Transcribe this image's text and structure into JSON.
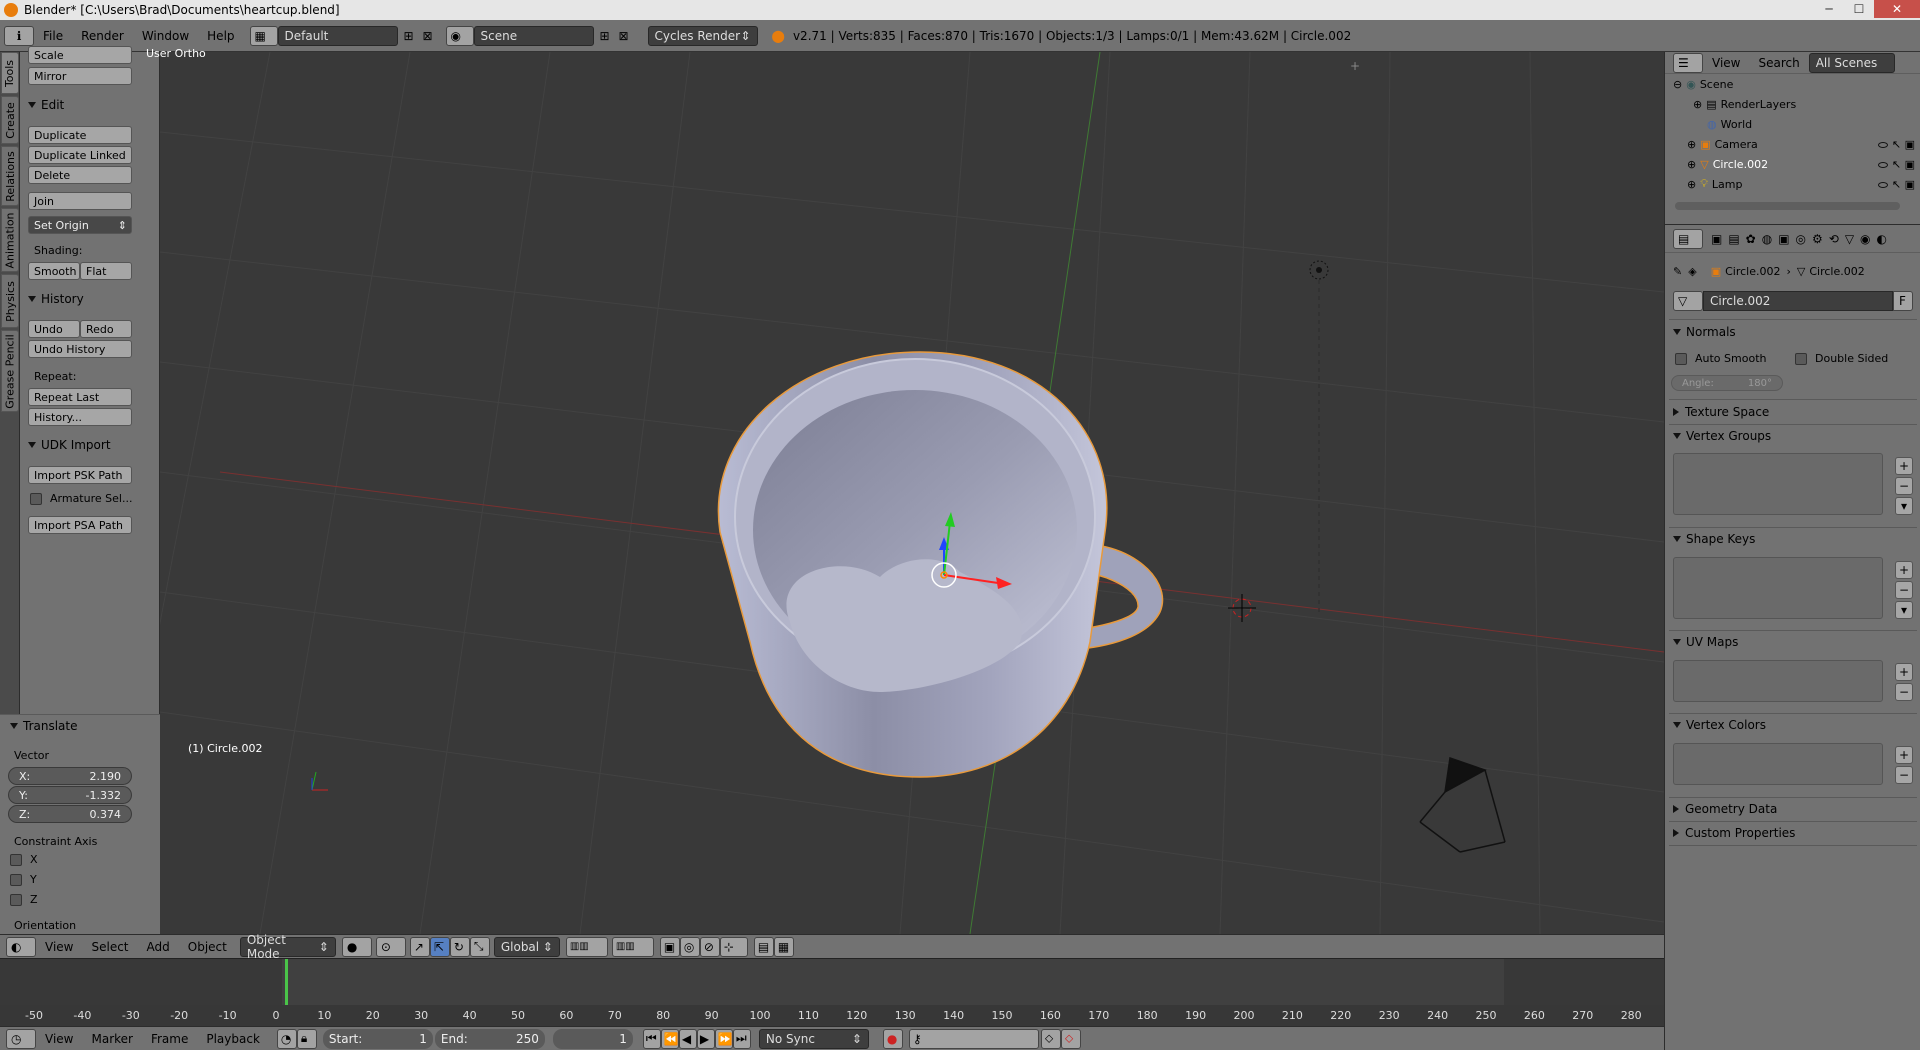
{
  "window": {
    "title": "Blender* [C:\\Users\\Brad\\Documents\\heartcup.blend]",
    "min": "─",
    "max": "☐",
    "close": "✕"
  },
  "infobar": {
    "menus": [
      "File",
      "Render",
      "Window",
      "Help"
    ],
    "layout": "Default",
    "scene": "Scene",
    "engine": "Cycles Render",
    "stats": "v2.71 | Verts:835 | Faces:870 | Tris:1670 | Objects:1/3 | Lamps:0/1 | Mem:43.62M | Circle.002"
  },
  "tabs": [
    "Tools",
    "Create",
    "Relations",
    "Animation",
    "Physics",
    "Grease Pencil"
  ],
  "tools": {
    "scale": "Scale",
    "mirror": "Mirror",
    "edit_header": "Edit",
    "duplicate": "Duplicate",
    "duplicate_linked": "Duplicate Linked",
    "delete": "Delete",
    "join": "Join",
    "set_origin": "Set Origin",
    "shading_label": "Shading:",
    "smooth": "Smooth",
    "flat": "Flat",
    "history_header": "History",
    "undo": "Undo",
    "redo": "Redo",
    "undo_history": "Undo History",
    "repeat_label": "Repeat:",
    "repeat_last": "Repeat Last",
    "history_btn": "History...",
    "udk_header": "UDK Import",
    "import_psk": "Import PSK Path",
    "armature": "Armature Sel...",
    "import_psa": "Import PSA Path"
  },
  "operator": {
    "header": "Translate",
    "vector_label": "Vector",
    "x_label": "X:",
    "x": "2.190",
    "y_label": "Y:",
    "y": "-1.332",
    "z_label": "Z:",
    "z": "0.374",
    "constraint_label": "Constraint Axis",
    "cx": "X",
    "cy": "Y",
    "cz": "Z",
    "orientation_label": "Orientation"
  },
  "viewport": {
    "view_name": "User Ortho",
    "object_label": "(1) Circle.002"
  },
  "view_header": {
    "menus": [
      "View",
      "Select",
      "Add",
      "Object"
    ],
    "mode": "Object Mode",
    "orientation": "Global"
  },
  "timeline": {
    "ticks": [
      "-50",
      "-40",
      "-30",
      "-20",
      "-10",
      "0",
      "10",
      "20",
      "30",
      "40",
      "50",
      "60",
      "70",
      "80",
      "90",
      "100",
      "110",
      "120",
      "130",
      "140",
      "150",
      "160",
      "170",
      "180",
      "190",
      "200",
      "210",
      "220",
      "230",
      "240",
      "250",
      "260",
      "270",
      "280"
    ],
    "menus": [
      "View",
      "Marker",
      "Frame",
      "Playback"
    ],
    "start_label": "Start:",
    "start": "1",
    "end_label": "End:",
    "end": "250",
    "current": "1",
    "sync": "No Sync"
  },
  "outliner": {
    "menus": [
      "View",
      "Search"
    ],
    "filter": "All Scenes",
    "rows": [
      "Scene",
      "RenderLayers",
      "World",
      "Camera",
      "Circle.002",
      "Lamp"
    ]
  },
  "properties": {
    "crumb_object": "Circle.002",
    "crumb_mesh": "Circle.002",
    "mesh_name": "Circle.002",
    "fake_user": "F",
    "normals": "Normals",
    "auto_smooth": "Auto Smooth",
    "double_sided": "Double Sided",
    "angle_label": "Angle:",
    "angle": "180°",
    "texture_space": "Texture Space",
    "vertex_groups": "Vertex Groups",
    "shape_keys": "Shape Keys",
    "uv_maps": "UV Maps",
    "vertex_colors": "Vertex Colors",
    "geometry_data": "Geometry Data",
    "custom_properties": "Custom Properties"
  }
}
